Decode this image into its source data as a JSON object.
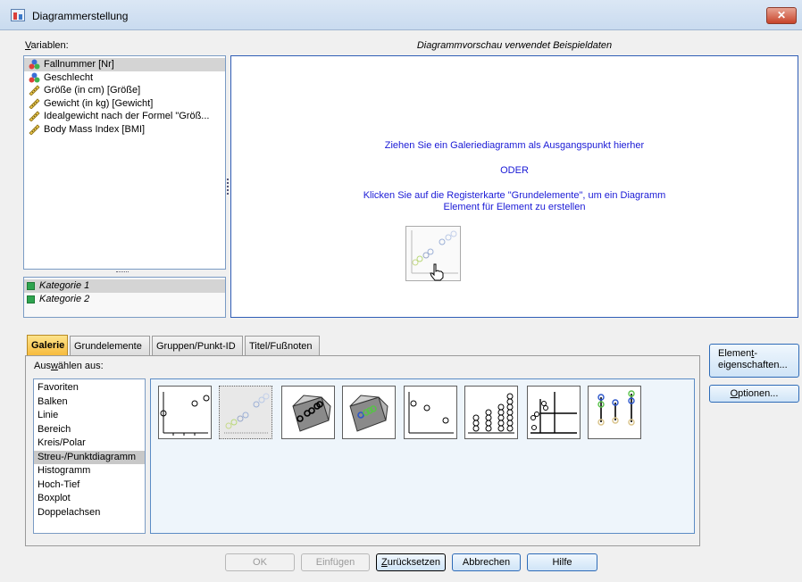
{
  "window": {
    "title": "Diagrammerstellung",
    "close_label": "✕"
  },
  "variables": {
    "label": "Variablen:",
    "items": [
      {
        "name": "Fallnummer [Nr]",
        "icon": "nominal-icon",
        "selected": true
      },
      {
        "name": "Geschlecht",
        "icon": "nominal-icon",
        "selected": false
      },
      {
        "name": "Größe (in cm) [Größe]",
        "icon": "scale-ruler-icon",
        "selected": false
      },
      {
        "name": "Gewicht (in kg) [Gewicht]",
        "icon": "scale-ruler-icon",
        "selected": false
      },
      {
        "name": "Idealgewicht nach der Formel \"Größ...",
        "icon": "scale-ruler-icon",
        "selected": false
      },
      {
        "name": "Body Mass Index [BMI]",
        "icon": "scale-ruler-icon",
        "selected": false
      }
    ]
  },
  "categories": {
    "items": [
      {
        "name": "Kategorie 1",
        "selected": true
      },
      {
        "name": "Kategorie 2",
        "selected": false
      }
    ]
  },
  "preview": {
    "header": "Diagrammvorschau verwendet Beispieldaten",
    "line1": "Ziehen Sie ein Galeriediagramm als Ausgangspunkt hierher",
    "line2": "ODER",
    "line3": "Klicken Sie auf die Registerkarte \"Grundelemente\", um ein Diagramm",
    "line4": "Element für Element zu erstellen"
  },
  "tabs": [
    {
      "label": "Galerie",
      "active": true
    },
    {
      "label": "Grundelemente",
      "active": false
    },
    {
      "label": "Gruppen/Punkt-ID",
      "active": false
    },
    {
      "label": "Titel/Fußnoten",
      "active": false
    }
  ],
  "gallery": {
    "choose_label": "Auswählen aus:",
    "types": [
      "Favoriten",
      "Balken",
      "Linie",
      "Bereich",
      "Kreis/Polar",
      "Streu-/Punktdiagramm",
      "Histogramm",
      "Hoch-Tief",
      "Boxplot",
      "Doppelachsen"
    ],
    "selected_type": "Streu-/Punktdiagramm",
    "thumbnails": [
      "simple-scatter-icon",
      "grouped-scatter-icon",
      "3d-scatter-icon",
      "3d-grouped-scatter-icon",
      "summary-point-icon",
      "dot-plot-icon",
      "scatterplot-matrix-icon",
      "drop-line-icon"
    ]
  },
  "side_buttons": {
    "element_properties_line1": "Element-",
    "element_properties_line2": "eigenschaften...",
    "options": "Optionen..."
  },
  "footer_buttons": {
    "ok": "OK",
    "paste": "Einfügen",
    "reset": "Zurücksetzen",
    "cancel": "Abbrechen",
    "help": "Hilfe"
  }
}
